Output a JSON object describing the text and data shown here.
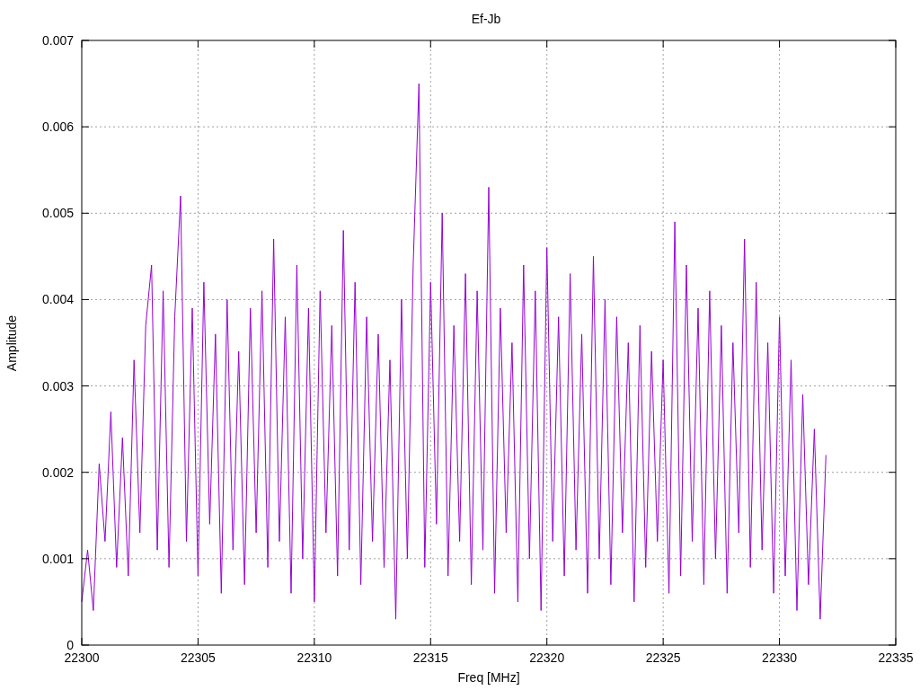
{
  "plot": {
    "chart_data": {
      "type": "line",
      "title": "Ef-Jb",
      "xlabel": "Freq [MHz]",
      "ylabel": "Amplitude",
      "xlim": [
        22300,
        22335
      ],
      "ylim": [
        0,
        0.007
      ],
      "grid": true,
      "xticks": [
        22300,
        22305,
        22310,
        22315,
        22320,
        22325,
        22330,
        22335
      ],
      "yticks": [
        0,
        0.001,
        0.002,
        0.003,
        0.004,
        0.005,
        0.006,
        0.007
      ],
      "x": [
        22300,
        22300.25,
        22300.5,
        22300.75,
        22301,
        22301.25,
        22301.5,
        22301.75,
        22302,
        22302.25,
        22302.5,
        22302.75,
        22303,
        22303.25,
        22303.5,
        22303.75,
        22304,
        22304.25,
        22304.5,
        22304.75,
        22305,
        22305.25,
        22305.5,
        22305.75,
        22306,
        22306.25,
        22306.5,
        22306.75,
        22307,
        22307.25,
        22307.5,
        22307.75,
        22308,
        22308.25,
        22308.5,
        22308.75,
        22309,
        22309.25,
        22309.5,
        22309.75,
        22310,
        22310.25,
        22310.5,
        22310.75,
        22311,
        22311.25,
        22311.5,
        22311.75,
        22312,
        22312.25,
        22312.5,
        22312.75,
        22313,
        22313.25,
        22313.5,
        22313.75,
        22314,
        22314.25,
        22314.5,
        22314.75,
        22315,
        22315.25,
        22315.5,
        22315.75,
        22316,
        22316.25,
        22316.5,
        22316.75,
        22317,
        22317.25,
        22317.5,
        22317.75,
        22318,
        22318.25,
        22318.5,
        22318.75,
        22319,
        22319.25,
        22319.5,
        22319.75,
        22320,
        22320.25,
        22320.5,
        22320.75,
        22321,
        22321.25,
        22321.5,
        22321.75,
        22322,
        22322.25,
        22322.5,
        22322.75,
        22323,
        22323.25,
        22323.5,
        22323.75,
        22324,
        22324.25,
        22324.5,
        22324.75,
        22325,
        22325.25,
        22325.5,
        22325.75,
        22326,
        22326.25,
        22326.5,
        22326.75,
        22327,
        22327.25,
        22327.5,
        22327.75,
        22328,
        22328.25,
        22328.5,
        22328.75,
        22329,
        22329.25,
        22329.5,
        22329.75,
        22330,
        22330.25,
        22330.5,
        22330.75,
        22331,
        22331.25,
        22331.5,
        22331.75,
        22332
      ],
      "series": [
        {
          "color": "#9400d3",
          "values": [
            0.0005,
            0.0011,
            0.0004,
            0.0021,
            0.0012,
            0.0027,
            0.0009,
            0.0024,
            0.0008,
            0.0033,
            0.0013,
            0.0037,
            0.0044,
            0.0011,
            0.0041,
            0.0009,
            0.0038,
            0.0052,
            0.0012,
            0.0039,
            0.0008,
            0.0042,
            0.0014,
            0.0036,
            0.0006,
            0.004,
            0.0011,
            0.0034,
            0.0007,
            0.0039,
            0.0013,
            0.0041,
            0.0009,
            0.0047,
            0.0012,
            0.0038,
            0.0006,
            0.0044,
            0.001,
            0.0039,
            0.0005,
            0.0041,
            0.0013,
            0.0037,
            0.0008,
            0.0048,
            0.0011,
            0.0042,
            0.0007,
            0.0038,
            0.0012,
            0.0036,
            0.0009,
            0.0033,
            0.0003,
            0.004,
            0.001,
            0.0044,
            0.0065,
            0.0009,
            0.0042,
            0.0014,
            0.005,
            0.0008,
            0.0037,
            0.0012,
            0.0043,
            0.0007,
            0.0041,
            0.0011,
            0.0053,
            0.0006,
            0.0039,
            0.0013,
            0.0035,
            0.0005,
            0.0044,
            0.001,
            0.0041,
            0.0004,
            0.0046,
            0.0012,
            0.0038,
            0.0008,
            0.0043,
            0.0011,
            0.0036,
            0.0006,
            0.0045,
            0.001,
            0.004,
            0.0007,
            0.0038,
            0.0013,
            0.0035,
            0.0005,
            0.0037,
            0.0009,
            0.0034,
            0.0012,
            0.0033,
            0.0006,
            0.0049,
            0.0008,
            0.0044,
            0.0012,
            0.0039,
            0.0007,
            0.0041,
            0.001,
            0.0037,
            0.0006,
            0.0035,
            0.0013,
            0.0047,
            0.0009,
            0.0042,
            0.0011,
            0.0035,
            0.0006,
            0.0038,
            0.0008,
            0.0033,
            0.0004,
            0.0029,
            0.0007,
            0.0025,
            0.0003,
            0.0022
          ]
        }
      ]
    }
  }
}
